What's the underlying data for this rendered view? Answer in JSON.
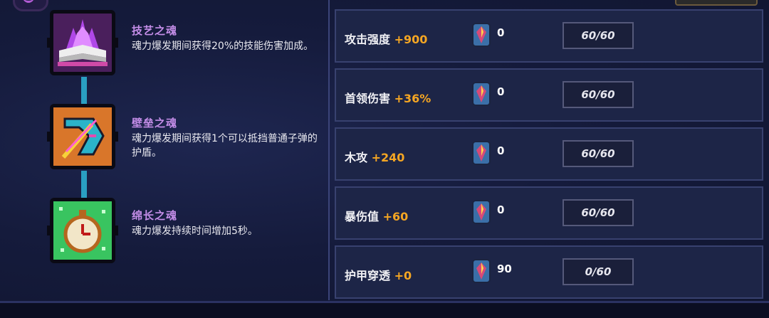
{
  "souls": [
    {
      "icon": "magic-book-icon",
      "title": "技艺之魂",
      "description": "魂力爆发期间获得20%的技能伤害加成。"
    },
    {
      "icon": "boomerang-shield-icon",
      "title": "壁垒之魂",
      "description": "魂力爆发期间获得1个可以抵挡普通子弹的护盾。"
    },
    {
      "icon": "pocket-watch-icon",
      "title": "绵长之魂",
      "description": "魂力爆发持续时间增加5秒。"
    }
  ],
  "stats": [
    {
      "label": "攻击强度",
      "bonus": "+900",
      "count": "0",
      "progress": "60/60"
    },
    {
      "label": "首领伤害",
      "bonus": "+36%",
      "count": "0",
      "progress": "60/60"
    },
    {
      "label": "木攻",
      "bonus": "+240",
      "count": "0",
      "progress": "60/60"
    },
    {
      "label": "暴伤值",
      "bonus": "+60",
      "count": "0",
      "progress": "60/60"
    },
    {
      "label": "护甲穿透",
      "bonus": "+0",
      "count": "90",
      "progress": "0/60"
    }
  ],
  "colors": {
    "soul_title": "#c58ee9",
    "bonus": "#f5a623",
    "connector": "#2a9fc2"
  }
}
